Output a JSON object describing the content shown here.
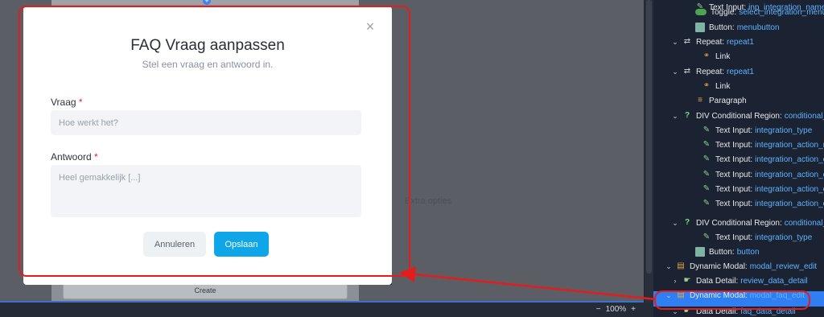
{
  "modal": {
    "title": "FAQ Vraag aanpassen",
    "subtitle": "Stel een vraag en antwoord in.",
    "close_icon": "×",
    "fields": {
      "vraag": {
        "label": "Vraag",
        "required": "*",
        "placeholder": "Hoe werkt het?"
      },
      "antwoord": {
        "label": "Antwoord",
        "required": "*",
        "placeholder": "Heel gemakkelijk [...]"
      }
    },
    "buttons": {
      "cancel": "Annuleren",
      "save": "Opslaan"
    }
  },
  "canvas": {
    "extra_opties": "Extra opties",
    "create_button": "Create",
    "plus_icon": "+"
  },
  "statusbar": {
    "zoom_minus": "−",
    "zoom_level": "100%",
    "zoom_plus": "+"
  },
  "tree": {
    "rows": [
      {
        "chev": "",
        "icon": "pencil-icon",
        "glyph": "✎",
        "type": "Text Input:",
        "val": "inp_integration_name"
      },
      {
        "chev": "",
        "icon": "toggle-icon",
        "glyph": "",
        "type": "Toggle:",
        "val": "select_integration_menu"
      },
      {
        "chev": "",
        "icon": "box-icon",
        "glyph": "",
        "type": "Button:",
        "val": "menubutton"
      },
      {
        "chev": "⌄",
        "icon": "repeat-icon",
        "glyph": "⇄",
        "type": "Repeat:",
        "val": "repeat1"
      },
      {
        "chev": "",
        "icon": "link-icon",
        "glyph": "⚭",
        "type": "Link",
        "val": ""
      },
      {
        "chev": "⌄",
        "icon": "repeat-icon",
        "glyph": "⇄",
        "type": "Repeat:",
        "val": "repeat1"
      },
      {
        "chev": "",
        "icon": "link-icon",
        "glyph": "⚭",
        "type": "Link",
        "val": ""
      },
      {
        "chev": "",
        "icon": "paragraph-icon",
        "glyph": "≡",
        "type": "Paragraph",
        "val": ""
      },
      {
        "chev": "⌄",
        "icon": "question-icon",
        "glyph": "?",
        "type": "DIV Conditional Region:",
        "val": "conditional_in"
      },
      {
        "chev": "",
        "icon": "pencil-icon",
        "glyph": "✎",
        "type": "Text Input:",
        "val": "integration_type"
      },
      {
        "chev": "",
        "icon": "pencil-icon",
        "glyph": "✎",
        "type": "Text Input:",
        "val": "integration_action_name"
      },
      {
        "chev": "",
        "icon": "pencil-icon",
        "glyph": "✎",
        "type": "Text Input:",
        "val": "integration_action_create"
      },
      {
        "chev": "",
        "icon": "pencil-icon",
        "glyph": "✎",
        "type": "Text Input:",
        "val": "integration_action_create"
      },
      {
        "chev": "",
        "icon": "pencil-icon",
        "glyph": "✎",
        "type": "Text Input:",
        "val": "integration_action_contac"
      },
      {
        "chev": "",
        "icon": "pencil-icon",
        "glyph": "✎",
        "type": "Text Input:",
        "val": "integration_action_contac"
      },
      {
        "chev": "⌄",
        "icon": "question-icon",
        "glyph": "?",
        "type": "DIV Conditional Region:",
        "val": "conditional_in"
      },
      {
        "chev": "",
        "icon": "pencil-icon",
        "glyph": "✎",
        "type": "Text Input:",
        "val": "integration_type"
      },
      {
        "chev": "",
        "icon": "box-icon",
        "glyph": "",
        "type": "Button:",
        "val": "button"
      },
      {
        "chev": "⌄",
        "icon": "modal-icon",
        "glyph": "▤",
        "type": "Dynamic Modal:",
        "val": "modal_review_edit"
      },
      {
        "chev": "›",
        "icon": "hand-icon",
        "glyph": "☛",
        "type": "Data Detail:",
        "val": "review_data_detail"
      },
      {
        "chev": "⌄",
        "icon": "modal-icon",
        "glyph": "▤",
        "type": "Dynamic Modal:",
        "val": "modal_faq_edit"
      },
      {
        "chev": "⌄",
        "icon": "hand-icon",
        "glyph": "☛",
        "type": "Data Detail:",
        "val": "faq_data_detail"
      }
    ]
  }
}
